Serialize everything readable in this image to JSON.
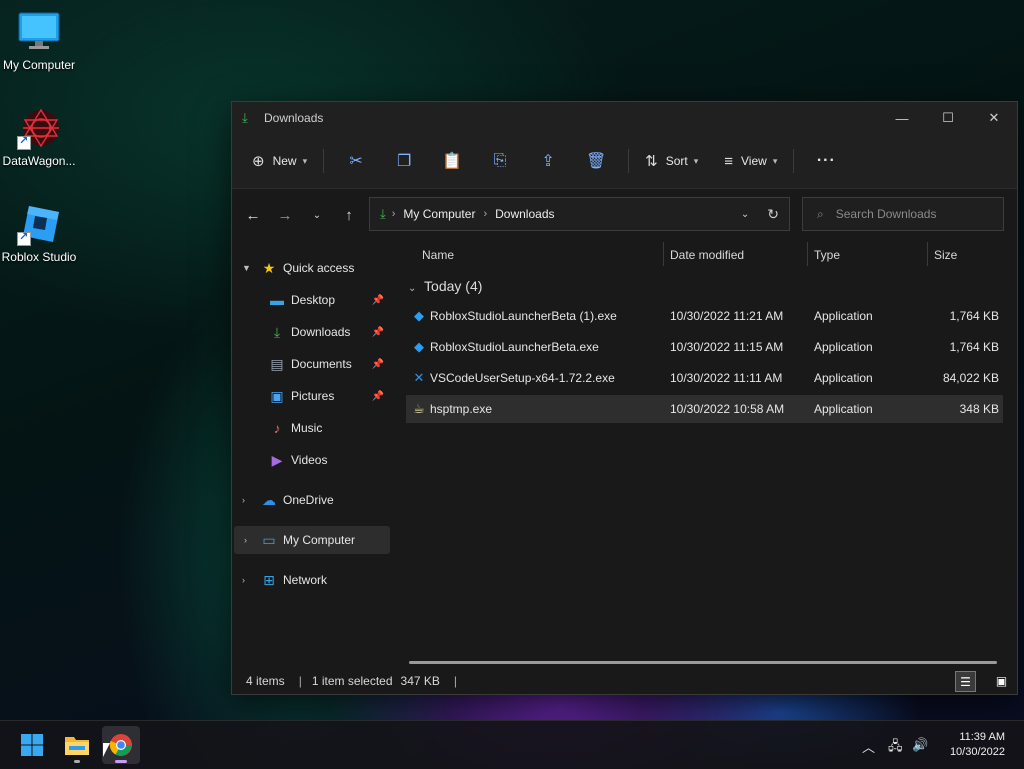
{
  "desktop": {
    "icons": [
      {
        "label": "My Computer",
        "icon": "monitor-icon"
      },
      {
        "label": "DataWagon...",
        "icon": "datawagon-icon"
      },
      {
        "label": "Roblox Studio",
        "icon": "roblox-studio-icon"
      }
    ]
  },
  "window": {
    "title": "Downloads",
    "controls": {
      "minimize": "—",
      "maximize": "☐",
      "close": "✕"
    }
  },
  "toolbar": {
    "new_label": "New",
    "sort_label": "Sort",
    "view_label": "View",
    "more": "···"
  },
  "address": {
    "crumbs": [
      "My Computer",
      "Downloads"
    ],
    "search_placeholder": "Search Downloads"
  },
  "navpane": {
    "quick_access": "Quick access",
    "items": [
      {
        "label": "Desktop",
        "pinned": true,
        "icon": "desktop-folder-icon"
      },
      {
        "label": "Downloads",
        "pinned": true,
        "icon": "downloads-folder-icon"
      },
      {
        "label": "Documents",
        "pinned": true,
        "icon": "documents-folder-icon"
      },
      {
        "label": "Pictures",
        "pinned": true,
        "icon": "pictures-folder-icon"
      },
      {
        "label": "Music",
        "pinned": false,
        "icon": "music-folder-icon"
      },
      {
        "label": "Videos",
        "pinned": false,
        "icon": "videos-folder-icon"
      }
    ],
    "onedrive": "OneDrive",
    "my_computer": "My Computer",
    "network": "Network",
    "pin_glyph": "📌"
  },
  "filelist": {
    "columns": [
      "Name",
      "Date modified",
      "Type",
      "Size"
    ],
    "group": "Today (4)",
    "rows": [
      {
        "name": "RobloxStudioLauncherBeta (1).exe",
        "date": "10/30/2022 11:21 AM",
        "type": "Application",
        "size": "1,764 KB",
        "icon": "roblox-file-icon"
      },
      {
        "name": "RobloxStudioLauncherBeta.exe",
        "date": "10/30/2022 11:15 AM",
        "type": "Application",
        "size": "1,764 KB",
        "icon": "roblox-file-icon"
      },
      {
        "name": "VSCodeUserSetup-x64-1.72.2.exe",
        "date": "10/30/2022 11:11 AM",
        "type": "Application",
        "size": "84,022 KB",
        "icon": "vscode-file-icon"
      },
      {
        "name": "hsptmp.exe",
        "date": "10/30/2022 10:58 AM",
        "type": "Application",
        "size": "348 KB",
        "icon": "hsp-file-icon"
      }
    ],
    "selected_index": 3
  },
  "statusbar": {
    "items_count": "4 items",
    "selection": "1 item selected",
    "selection_size": "347 KB",
    "divider": "|"
  },
  "taskbar": {
    "time": "11:39 AM",
    "date": "10/30/2022",
    "apps": [
      "start-icon",
      "file-explorer-icon",
      "chrome-icon"
    ]
  },
  "colors": {
    "accent_green": "#3fb950",
    "selection": "#2e2e2e",
    "window_bg": "#191919"
  }
}
